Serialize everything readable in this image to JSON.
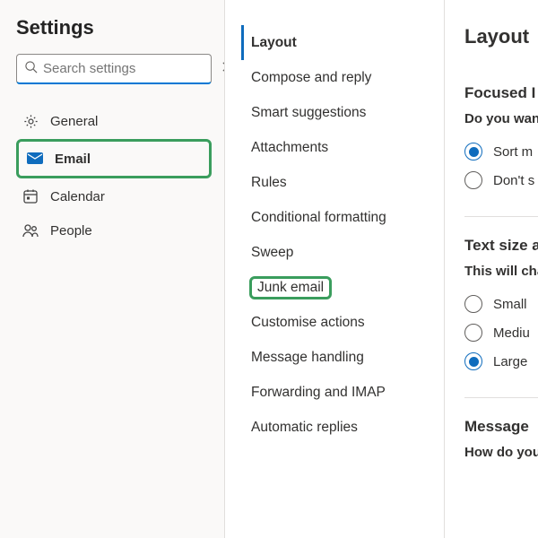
{
  "header": {
    "title": "Settings"
  },
  "search": {
    "placeholder": "Search settings"
  },
  "nav": {
    "items": [
      {
        "key": "general",
        "label": "General",
        "icon": "gear-icon"
      },
      {
        "key": "email",
        "label": "Email",
        "icon": "mail-icon",
        "active": true,
        "highlighted": true
      },
      {
        "key": "calendar",
        "label": "Calendar",
        "icon": "calendar-icon"
      },
      {
        "key": "people",
        "label": "People",
        "icon": "people-icon"
      }
    ]
  },
  "subnav": {
    "items": [
      {
        "key": "layout",
        "label": "Layout",
        "selected": true
      },
      {
        "key": "compose",
        "label": "Compose and reply"
      },
      {
        "key": "smart",
        "label": "Smart suggestions"
      },
      {
        "key": "attach",
        "label": "Attachments"
      },
      {
        "key": "rules",
        "label": "Rules"
      },
      {
        "key": "condfmt",
        "label": "Conditional formatting"
      },
      {
        "key": "sweep",
        "label": "Sweep"
      },
      {
        "key": "junk",
        "label": "Junk email",
        "highlighted": true
      },
      {
        "key": "customise",
        "label": "Customise actions"
      },
      {
        "key": "msghandle",
        "label": "Message handling"
      },
      {
        "key": "fwd",
        "label": "Forwarding and IMAP"
      },
      {
        "key": "autoreply",
        "label": "Automatic replies"
      }
    ]
  },
  "pane": {
    "title": "Layout",
    "sections": {
      "focused": {
        "title": "Focused I",
        "question": "Do you wan",
        "options": [
          {
            "label": "Sort m",
            "checked": true
          },
          {
            "label": "Don't s",
            "checked": false
          }
        ]
      },
      "textsize": {
        "title": "Text size a",
        "question": "This will cha",
        "options": [
          {
            "label": "Small",
            "checked": false
          },
          {
            "label": "Mediu",
            "checked": false
          },
          {
            "label": "Large",
            "checked": true
          }
        ]
      },
      "message": {
        "title": "Message ",
        "question": "How do you"
      }
    }
  }
}
